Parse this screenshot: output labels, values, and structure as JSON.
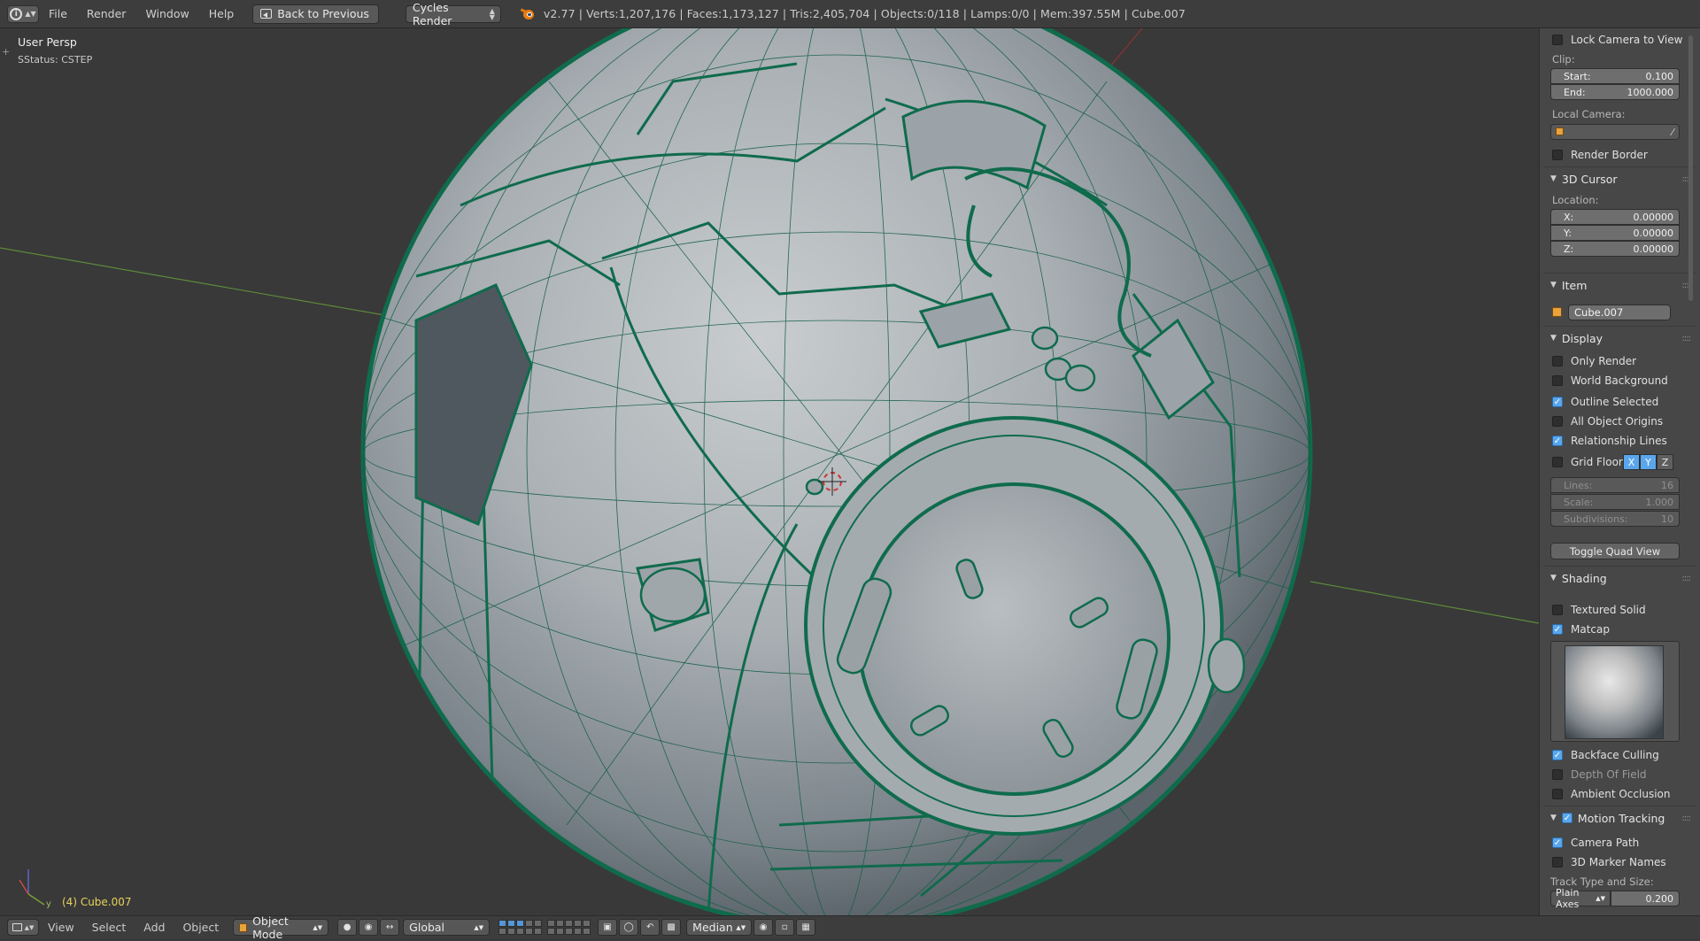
{
  "topbar": {
    "menu": [
      "File",
      "Render",
      "Window",
      "Help"
    ],
    "back_button": "Back to Previous",
    "render_engine": "Cycles Render",
    "stats": "v2.77 | Verts:1,207,176 | Faces:1,173,127 | Tris:2,405,704 | Objects:0/118 | Lamps:0/0 | Mem:397.55M | Cube.007"
  },
  "viewport": {
    "view_name": "User Persp",
    "status": "SStatus: CSTEP",
    "active_object": "(4) Cube.007",
    "axis_y_label": "y"
  },
  "bottombar": {
    "menu": [
      "View",
      "Select",
      "Add",
      "Object"
    ],
    "mode": "Object Mode",
    "orientation": "Global",
    "pivot": "Median"
  },
  "panel": {
    "lock_camera": "Lock Camera to View",
    "clip_label": "Clip:",
    "clip_start_label": "Start:",
    "clip_start": "0.100",
    "clip_end_label": "End:",
    "clip_end": "1000.000",
    "local_camera_label": "Local Camera:",
    "render_border": "Render Border",
    "cursor_header": "3D Cursor",
    "location_label": "Location:",
    "cursor_x_label": "X:",
    "cursor_x": "0.00000",
    "cursor_y_label": "Y:",
    "cursor_y": "0.00000",
    "cursor_z_label": "Z:",
    "cursor_z": "0.00000",
    "item_header": "Item",
    "item_name": "Cube.007",
    "display_header": "Display",
    "only_render": "Only Render",
    "world_background": "World Background",
    "outline_selected": "Outline Selected",
    "all_object_origins": "All Object Origins",
    "relationship_lines": "Relationship Lines",
    "grid_floor": "Grid Floor",
    "grid_x": "X",
    "grid_y": "Y",
    "grid_z": "Z",
    "lines_label": "Lines:",
    "lines_value": "16",
    "scale_label": "Scale:",
    "scale_value": "1.000",
    "subdivisions_label": "Subdivisions:",
    "subdivisions_value": "10",
    "toggle_quad": "Toggle Quad View",
    "shading_header": "Shading",
    "textured_solid": "Textured Solid",
    "matcap": "Matcap",
    "backface_culling": "Backface Culling",
    "depth_of_field": "Depth Of Field",
    "ambient_occlusion": "Ambient Occlusion",
    "motion_tracking_header": "Motion Tracking",
    "camera_path": "Camera Path",
    "marker_names": "3D Marker Names",
    "track_type_label": "Track Type and Size:",
    "track_type": "Plain Axes",
    "track_size": "0.200"
  },
  "colors": {
    "wire": "#0f6b4c",
    "accent": "#5aa6ec",
    "object_label": "#e8d25a"
  },
  "icons": [
    "info-icon",
    "blender-logo-icon",
    "back-icon",
    "cube-icon",
    "eyedropper-icon",
    "matcap-sphere"
  ]
}
